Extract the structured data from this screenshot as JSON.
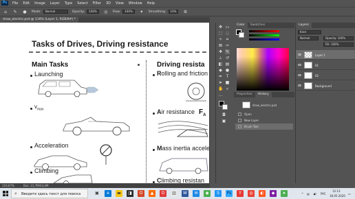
{
  "menubar": {
    "logo": "Ps",
    "items": [
      "File",
      "Edit",
      "Image",
      "Layer",
      "Type",
      "Select",
      "Filter",
      "3D",
      "View",
      "Window",
      "Help"
    ]
  },
  "options": {
    "mode_label": "Mode:",
    "mode_value": "Normal",
    "opacity_label": "Opacity:",
    "opacity_value": "100%",
    "flow_label": "Flow:",
    "flow_value": "100%",
    "smoothing_label": "Smoothing:",
    "smoothing_value": "10%"
  },
  "document": {
    "tab_label": "draw_electric.psd @ 116% (Layer 1, RGB/8#) *",
    "title": "Tasks of Drives, Driving resistance",
    "left_heading": "Main Tasks",
    "right_heading": "Driving resista",
    "left_items": [
      "Launching",
      "Acceleration",
      "Climbing"
    ],
    "v_max": "v",
    "v_max_sub": "max",
    "right_items": [
      {
        "first": "R",
        "rest": "olling and friction"
      },
      {
        "first": "A",
        "rest": "ir resistance"
      },
      {
        "first": "M",
        "rest": "ass inertia accele"
      },
      {
        "first": "C",
        "rest": "limbing resistan"
      }
    ],
    "fa_label": "F",
    "fa_sub": "A"
  },
  "color_panel": {
    "tabs": [
      "Color",
      "Swatches"
    ]
  },
  "history_panel": {
    "tabs": [
      "Properties",
      "History"
    ],
    "snapshot": "draw_electric.psd",
    "rows": [
      "Open",
      "New Layer",
      "Brush Tool"
    ]
  },
  "layers_panel": {
    "tab": "Layers",
    "kind": "Kind",
    "blend": "Normal",
    "opacity": "Opacity: 100%",
    "fill": "Fill: 100%",
    "layers": [
      "Layer 1",
      "01",
      "02",
      "Background"
    ]
  },
  "status": {
    "zoom": "116,67%",
    "doc": "Doc: 21,7M/43,4M"
  },
  "taskbar": {
    "search_placeholder": "Введите здесь текст для поиска",
    "lang": "РУС",
    "time": "12:13",
    "date": "18.05.2020"
  },
  "colors": {
    "ui_bg": "#535353",
    "ui_dark": "#424242",
    "taskbar": "#dfe6ee",
    "selected_row": "#6d6d6d"
  }
}
